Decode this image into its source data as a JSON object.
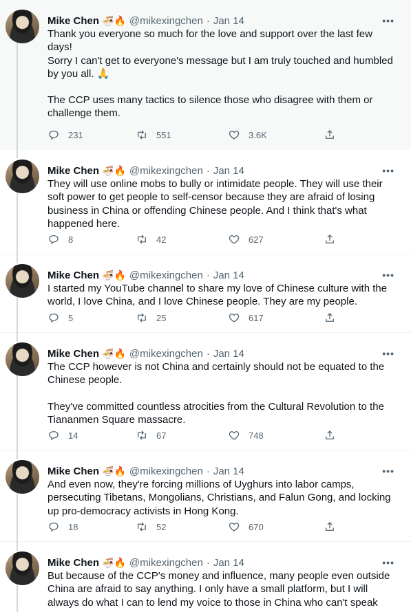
{
  "author": {
    "name": "Mike Chen",
    "emoji": "🍜🔥",
    "handle": "@mikexingchen",
    "separator": "·",
    "avatar_icon": "profile-photo"
  },
  "tweets": [
    {
      "date": "Jan 14",
      "paragraphs": [
        "Thank you everyone so much for the love and support over the last few days!\nSorry I can't get to everyone's message but I am truly touched and humbled by you all. 🙏",
        "The CCP uses many tactics to silence those who disagree with them or challenge them."
      ],
      "replies": "231",
      "retweets": "551",
      "likes": "3.6K"
    },
    {
      "date": "Jan 14",
      "paragraphs": [
        "They will use online mobs to bully or intimidate people. They will use their soft power to get people to self-censor because they are afraid of losing business in China or offending Chinese people. And I think that's what happened here."
      ],
      "replies": "8",
      "retweets": "42",
      "likes": "627"
    },
    {
      "date": "Jan 14",
      "paragraphs": [
        "I started my YouTube channel to share my love of Chinese culture with the world, I love China, and I love Chinese people. They are my people."
      ],
      "replies": "5",
      "retweets": "25",
      "likes": "617"
    },
    {
      "date": "Jan 14",
      "paragraphs": [
        "The CCP however is not China and certainly should not be equated to the Chinese people.",
        "They've committed countless atrocities from the Cultural Revolution to the Tiananmen Square massacre."
      ],
      "replies": "14",
      "retweets": "67",
      "likes": "748"
    },
    {
      "date": "Jan 14",
      "paragraphs": [
        "And even now, they're forcing millions of Uyghurs into labor camps, persecuting Tibetans, Mongolians, Christians, and Falun Gong, and locking up pro-democracy activists in Hong Kong."
      ],
      "replies": "18",
      "retweets": "52",
      "likes": "670"
    },
    {
      "date": "Jan 14",
      "paragraphs": [
        "But because of the CCP's money and influence, many people even outside China are afraid to say anything. I only have a small platform, but I will always do what I can to lend my voice to those in China who can't speak out."
      ]
    }
  ],
  "colors": {
    "text": "#0f1419",
    "secondary": "#536471",
    "thread_line": "#cfd9de",
    "highlight_bg": "#f7f9f9"
  },
  "icons": [
    "more-icon",
    "reply-icon",
    "retweet-icon",
    "like-icon",
    "share-icon"
  ]
}
